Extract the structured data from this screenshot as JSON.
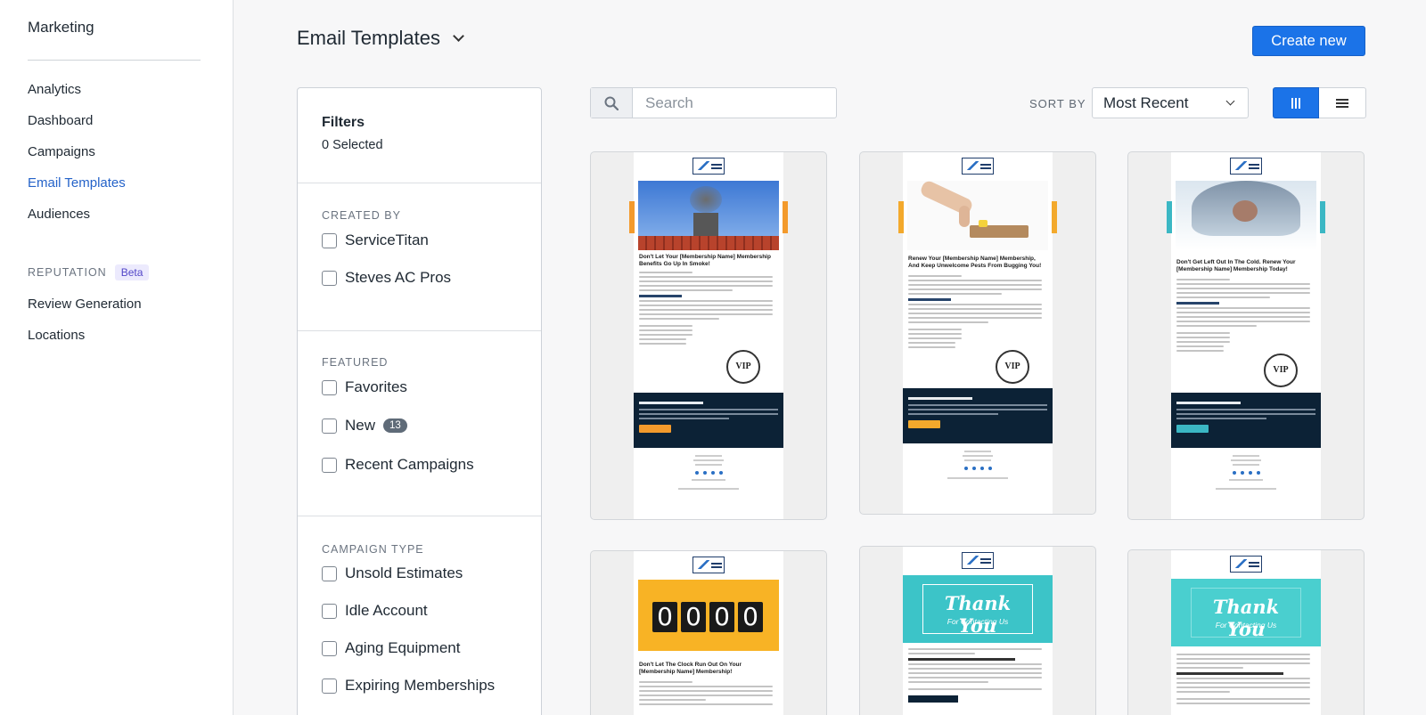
{
  "sidebar": {
    "title": "Marketing",
    "items": [
      {
        "label": "Analytics"
      },
      {
        "label": "Dashboard"
      },
      {
        "label": "Campaigns"
      },
      {
        "label": "Email Templates",
        "active": true
      },
      {
        "label": "Audiences"
      }
    ],
    "reputation_label": "REPUTATION",
    "reputation_badge": "Beta",
    "reputation_items": [
      {
        "label": "Review Generation"
      },
      {
        "label": "Locations"
      }
    ]
  },
  "header": {
    "title": "Email Templates",
    "create_button": "Create new"
  },
  "filters": {
    "title": "Filters",
    "selected": "0 Selected",
    "groups": [
      {
        "label": "CREATED BY",
        "options": [
          "ServiceTitan",
          "Steves AC Pros"
        ]
      },
      {
        "label": "FEATURED",
        "options": [
          "Favorites",
          "New",
          "Recent Campaigns"
        ],
        "new_count": "13"
      },
      {
        "label": "CAMPAIGN TYPE",
        "options": [
          "Unsold Estimates",
          "Idle Account",
          "Aging Equipment",
          "Expiring Memberships"
        ]
      }
    ]
  },
  "toolbar": {
    "search_placeholder": "Search",
    "sort_label": "SORT BY",
    "sort_value": "Most Recent",
    "view_mode": "grid"
  },
  "templates": [
    {
      "headline": "Don't Let Your [Membership Name] Membership Benefits Go Up In Smoke!",
      "accent": "#f39a2c",
      "cta_color": "#f39a2c"
    },
    {
      "headline": "Renew Your [Membership Name] Membership, And Keep Unwelcome Pests From Bugging You!",
      "accent": "#f3a92c",
      "cta_color": "#f3a92c"
    },
    {
      "headline": "Don't Get Left Out In The Cold. Renew Your [Membership Name] Membership Today!",
      "accent": "#3bb7c4",
      "cta_color": "#3bb7c4"
    },
    {
      "headline": "Don't Let The Clock Run Out On Your [Membership Name] Membership!",
      "digits": [
        "0",
        "0",
        "0",
        "0"
      ]
    },
    {
      "headline": "",
      "hero_title": "Thank You",
      "hero_subtitle": "For Contacting Us"
    },
    {
      "headline": "",
      "hero_title": "Thank You",
      "hero_subtitle": "For Contacting Us"
    }
  ],
  "colors": {
    "accent_blue": "#1b73e8",
    "active_nav": "#2563c9"
  }
}
